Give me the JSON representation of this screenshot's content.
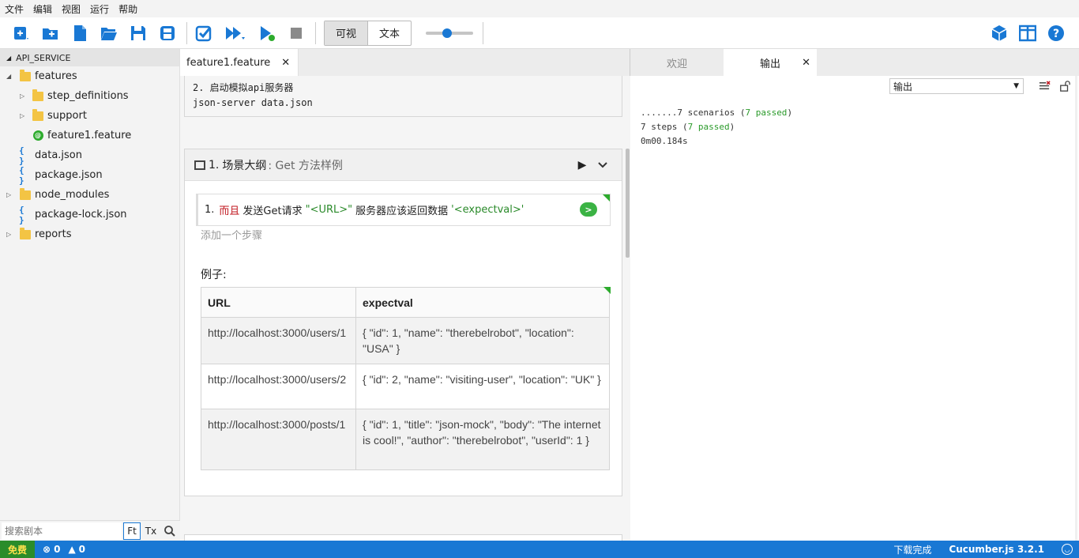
{
  "menu": [
    "文件",
    "编辑",
    "视图",
    "运行",
    "帮助"
  ],
  "toolbar": {
    "view_visual": "可视",
    "view_text": "文本",
    "zoom_level": 0.45
  },
  "sidebar": {
    "title": "API_SERVICE",
    "tree": [
      {
        "label": "features",
        "type": "folder",
        "expanded": true
      },
      {
        "label": "step_definitions",
        "type": "folder",
        "expanded": false
      },
      {
        "label": "support",
        "type": "folder",
        "expanded": false
      },
      {
        "label": "feature1.feature",
        "type": "feature"
      },
      {
        "label": "data.json",
        "type": "json"
      },
      {
        "label": "package.json",
        "type": "json"
      },
      {
        "label": "node_modules",
        "type": "folder",
        "expanded": false
      },
      {
        "label": "package-lock.json",
        "type": "json"
      },
      {
        "label": "reports",
        "type": "folder",
        "expanded": false
      }
    ],
    "search_placeholder": "搜索剧本",
    "search_ft": "Ft",
    "search_tx": "Tx"
  },
  "editor": {
    "tab": "feature1.feature",
    "prev_line1": "2. 启动模拟api服务器",
    "prev_line2": "json-server data.json",
    "scenario": {
      "number": "1.",
      "keyword": "场景大纲",
      "title": ": Get 方法样例"
    },
    "step": {
      "number": "1.",
      "keyword": "而且",
      "text_a": "发送Get请求",
      "param_url": "\"<URL>\"",
      "text_b": "服务器应该返回数据",
      "param_val": "'<expectval>'",
      "run_label": ">"
    },
    "add_step": "添加一个步骤",
    "examples_label": "例子:",
    "examples": {
      "headers": [
        "URL",
        "expectval"
      ],
      "rows": [
        [
          "http://localhost:3000/users/1",
          "{ \"id\": 1, \"name\": \"therebelrobot\", \"location\": \"USA\" }"
        ],
        [
          "http://localhost:3000/users/2",
          "{ \"id\": 2, \"name\": \"visiting-user\", \"location\": \"UK\" }"
        ],
        [
          "http://localhost:3000/posts/1",
          "{ \"id\": 1, \"title\": \"json-mock\", \"body\": \"The internet is cool!\", \"author\": \"therebelrobot\", \"userId\": 1 }"
        ]
      ]
    }
  },
  "output": {
    "tab_welcome": "欢迎",
    "tab_output": "输出",
    "select_value": "输出",
    "line1_a": ".......7 scenarios (",
    "line1_b": "7 passed",
    "line1_c": ")",
    "line2_a": "7 steps (",
    "line2_b": "7 passed",
    "line2_c": ")",
    "line3": "0m00.184s"
  },
  "status": {
    "free": "免费",
    "errors": "0",
    "warnings": "0",
    "download": "下载完成",
    "version": "Cucumber.js 3.2.1"
  },
  "colors": {
    "accent": "#1978d4",
    "pass": "#2a9a2a",
    "keyword_and": "#c0161e"
  }
}
